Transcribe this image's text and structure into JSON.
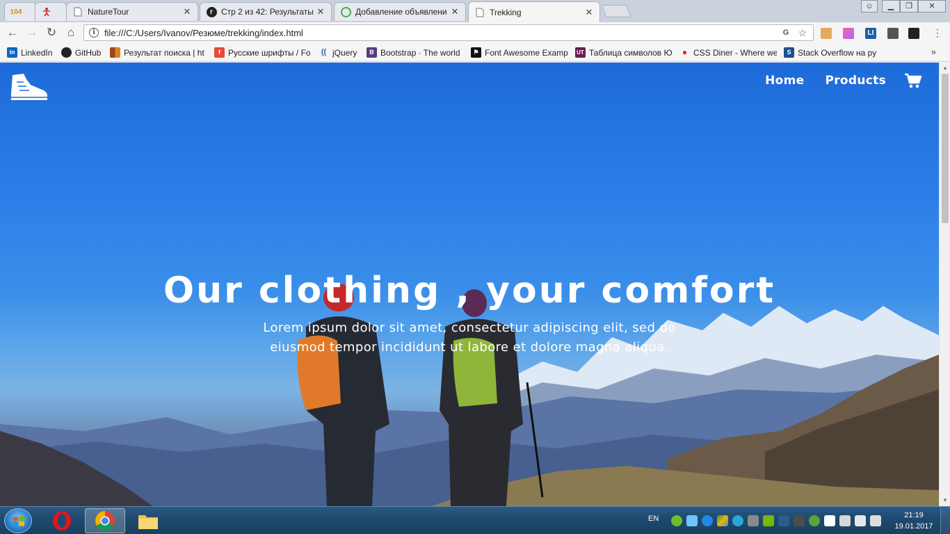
{
  "browser": {
    "tabs": [
      {
        "label": "104",
        "kind": "pinned",
        "favicon": "counter-icon"
      },
      {
        "label": "",
        "kind": "pinned",
        "favicon": "red-figure-icon"
      },
      {
        "label": "NatureTour",
        "kind": "normal",
        "favicon": "page-icon"
      },
      {
        "label": "Стр 2 из 42: Результаты",
        "kind": "normal",
        "favicon": "r-icon"
      },
      {
        "label": "Добавление объявлени",
        "kind": "normal",
        "favicon": "avito-icon"
      },
      {
        "label": "Trekking",
        "kind": "active",
        "favicon": "page-icon"
      }
    ],
    "url": "file:///C:/Users/Ivanov/Резюме/trekking/index.html",
    "bookmarks": [
      {
        "label": "LinkedIn",
        "icon": "linkedin-icon",
        "color": "#0a66c2",
        "glyph": "in"
      },
      {
        "label": "GitHub",
        "icon": "github-icon",
        "color": "#222222",
        "glyph": "●"
      },
      {
        "label": "Результат поиска | ht",
        "icon": "blocks-icon",
        "color": "#a0441b",
        "glyph": "■"
      },
      {
        "label": "Русские шрифты / Fo",
        "icon": "fonts-icon",
        "color": "#e84a3c",
        "glyph": "f"
      },
      {
        "label": "jQuery",
        "icon": "jquery-icon",
        "color": "#1b5fa8",
        "glyph": "(("
      },
      {
        "label": "Bootstrap · The world",
        "icon": "bootstrap-icon",
        "color": "#563d7c",
        "glyph": "B"
      },
      {
        "label": "Font Awesome Examp",
        "icon": "font-awesome-icon",
        "color": "#111111",
        "glyph": "⚑"
      },
      {
        "label": "Таблица символов Ю",
        "icon": "symbols-icon",
        "color": "#6a1d4f",
        "glyph": "UT"
      },
      {
        "label": "CSS Diner - Where we",
        "icon": "css-diner-icon",
        "color": "#e02222",
        "glyph": "●"
      },
      {
        "label": "Stack Overflow на ру",
        "icon": "stackoverflow-icon",
        "color": "#1f4e8c",
        "glyph": "S"
      }
    ]
  },
  "site": {
    "nav": [
      {
        "label": "Home"
      },
      {
        "label": "Products"
      }
    ],
    "hero": {
      "title": "Our clothing , your comfort",
      "text": "Lorem ipsum dolor sit amet, consectetur adipiscing elit, sed do eiusmod tempor incididunt ut labore et dolore magna aliqua."
    }
  },
  "taskbar": {
    "apps": [
      {
        "name": "opera-icon",
        "active": false
      },
      {
        "name": "chrome-icon",
        "active": true
      },
      {
        "name": "file-explorer-icon",
        "active": false
      }
    ],
    "lang": "EN",
    "time": "21:19",
    "date": "19.01.2017"
  }
}
